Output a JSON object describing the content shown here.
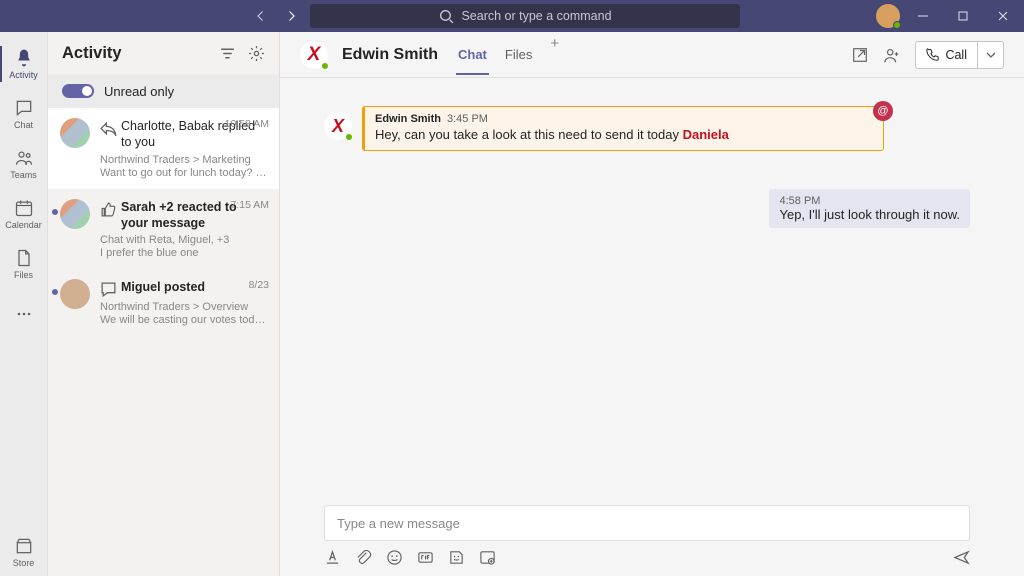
{
  "titlebar": {
    "search_placeholder": "Search or type a command"
  },
  "rail": {
    "activity": "Activity",
    "chat": "Chat",
    "teams": "Teams",
    "calendar": "Calendar",
    "files": "Files",
    "store": "Store"
  },
  "panel": {
    "title": "Activity",
    "unread_label": "Unread only"
  },
  "feed": [
    {
      "title_pre": "Charlotte, Babak replied to you",
      "time": "10:58 AM",
      "sub": "Northwind Traders > Marketing",
      "preview": "Want to go out for lunch today? It's my…"
    },
    {
      "title_pre": "Sarah +2 reacted to your message",
      "time": "7:15 AM",
      "sub": "Chat with Reta, Miguel, +3",
      "preview": "I prefer the blue one"
    },
    {
      "title_pre": "Miguel posted",
      "time": "8/23",
      "sub": "Northwind Traders > Overview",
      "preview": "We will be casting our votes today, every…"
    }
  ],
  "chat": {
    "contact_initial": "X",
    "contact_name": "Edwin Smith",
    "tabs": {
      "chat": "Chat",
      "files": "Files"
    },
    "call_label": "Call"
  },
  "messages": {
    "in": {
      "author": "Edwin Smith",
      "time": "3:45 PM",
      "text": "Hey, can you take a look at this need to send it today ",
      "mention": "Daniela"
    },
    "out": {
      "time": "4:58 PM",
      "text": "Yep, I'll just look through it now."
    }
  },
  "composer": {
    "placeholder": "Type a new message"
  }
}
